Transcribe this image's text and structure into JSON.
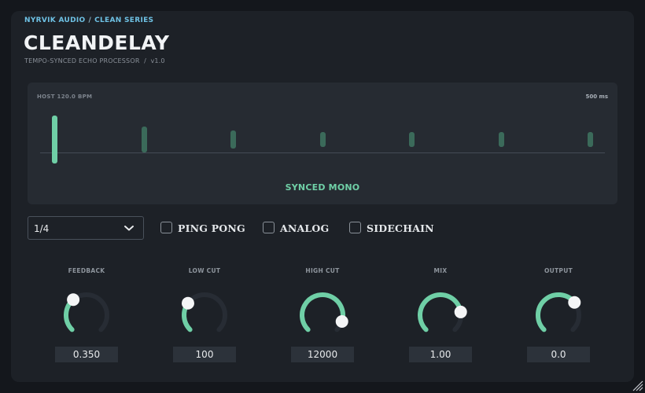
{
  "breadcrumb": {
    "brand": "NYRVIK AUDIO",
    "separator": "/",
    "series": "CLEAN SERIES"
  },
  "header": {
    "title": "CLEANDELAY",
    "subtitle": "TEMPO-SYNCED ECHO PROCESSOR  /  v1.0"
  },
  "display": {
    "host_label": "HOST  120.0 BPM",
    "delay_time": "500 ms",
    "mode": "SYNCED MONO",
    "tap_count": 7
  },
  "controls": {
    "division": {
      "value": "1/4"
    },
    "toggles": [
      {
        "label": "PING PONG",
        "checked": false
      },
      {
        "label": "ANALOG",
        "checked": false
      },
      {
        "label": "SIDECHAIN",
        "checked": false
      }
    ]
  },
  "knobs": [
    {
      "label": "FEEDBACK",
      "value": "0.350",
      "position": 0.35
    },
    {
      "label": "LOW CUT",
      "value": "100",
      "position": 0.3
    },
    {
      "label": "HIGH CUT",
      "value": "12000",
      "position": 0.9
    },
    {
      "label": "MIX",
      "value": "1.00",
      "position": 0.8
    },
    {
      "label": "OUTPUT",
      "value": "0.0",
      "position": 0.69
    }
  ],
  "colors": {
    "accent": "#6fcfa6",
    "link": "#6ec1e4",
    "panel": "#1d2127",
    "track": "#272c34"
  },
  "icons": {
    "dropdown": "chevron-down-icon",
    "resize": "resize-grip-icon"
  }
}
